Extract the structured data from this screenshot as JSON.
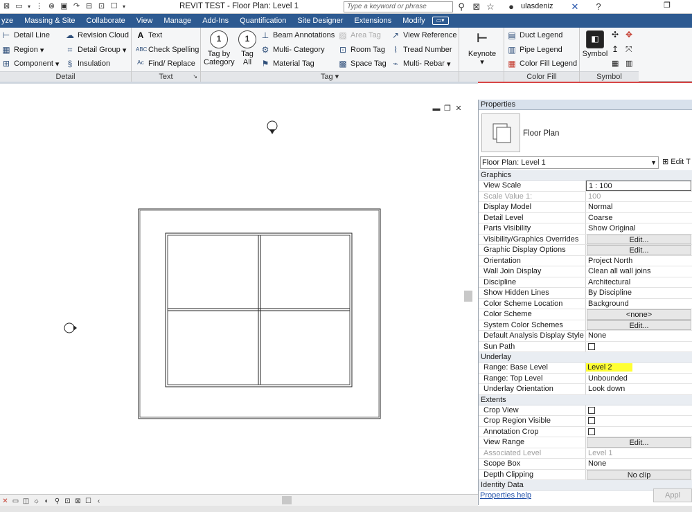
{
  "titlebar": {
    "title": "REVIT TEST - Floor Plan: Level 1",
    "search_placeholder": "Type a keyword or phrase",
    "user": "ulasdeniz",
    "qat_icons": [
      "close-x-icon",
      "open-icon",
      "save-icon",
      "undo-icon",
      "settings-icon",
      "redo-icon",
      "print-icon",
      "measure-icon",
      "sync-icon"
    ]
  },
  "tabs": [
    "yze",
    "Massing & Site",
    "Collaborate",
    "View",
    "Manage",
    "Add-Ins",
    "Quantification",
    "Site Designer",
    "Extensions",
    "Modify"
  ],
  "ribbon": {
    "detail": {
      "title": "Detail",
      "items": [
        "Detail Line",
        "Region",
        "Component",
        "Revision Cloud",
        "Detail Group",
        "Insulation"
      ]
    },
    "text": {
      "title": "Text",
      "items": [
        "Text",
        "Check Spelling",
        "Find/ Replace"
      ]
    },
    "tag": {
      "title": "Tag",
      "tag_by_category": "Tag by Category",
      "tag_all": "Tag All",
      "items": [
        "Beam Annotations",
        "Multi- Category",
        "Material Tag",
        "Area Tag",
        "Room Tag",
        "Space Tag",
        "View Reference",
        "Tread Number",
        "Multi- Rebar"
      ]
    },
    "keynote": {
      "label": "Keynote"
    },
    "color_fill": {
      "title": "Color Fill",
      "items": [
        "Duct Legend",
        "Pipe Legend",
        "Color Fill Legend"
      ]
    },
    "symbol": {
      "title": "Symbol",
      "label": "Symbol"
    }
  },
  "properties": {
    "title": "Properties",
    "type_name": "Floor Plan",
    "instance": "Floor Plan: Level 1",
    "edit_type": "Edit T",
    "groups": {
      "graphics": "Graphics",
      "underlay": "Underlay",
      "extents": "Extents",
      "identity": "Identity Data"
    },
    "graphics_rows": [
      {
        "k": "View Scale",
        "v": "1 : 100"
      },
      {
        "k": "Scale Value    1:",
        "v": "100"
      },
      {
        "k": "Display Model",
        "v": "Normal"
      },
      {
        "k": "Detail Level",
        "v": "Coarse"
      },
      {
        "k": "Parts Visibility",
        "v": "Show Original"
      },
      {
        "k": "Visibility/Graphics Overrides",
        "v": "Edit..."
      },
      {
        "k": "Graphic Display Options",
        "v": "Edit..."
      },
      {
        "k": "Orientation",
        "v": "Project North"
      },
      {
        "k": "Wall Join Display",
        "v": "Clean all wall joins"
      },
      {
        "k": "Discipline",
        "v": "Architectural"
      },
      {
        "k": "Show Hidden Lines",
        "v": "By Discipline"
      },
      {
        "k": "Color Scheme Location",
        "v": "Background"
      },
      {
        "k": "Color Scheme",
        "v": "<none>"
      },
      {
        "k": "System Color Schemes",
        "v": "Edit..."
      },
      {
        "k": "Default Analysis Display Style",
        "v": "None"
      },
      {
        "k": "Sun Path",
        "v": ""
      }
    ],
    "underlay_rows": [
      {
        "k": "Range: Base Level",
        "v": "Level 2"
      },
      {
        "k": "Range: Top Level",
        "v": "Unbounded"
      },
      {
        "k": "Underlay Orientation",
        "v": "Look down"
      }
    ],
    "extents_rows": [
      {
        "k": "Crop View",
        "v": ""
      },
      {
        "k": "Crop Region Visible",
        "v": ""
      },
      {
        "k": "Annotation Crop",
        "v": ""
      },
      {
        "k": "View Range",
        "v": "Edit..."
      },
      {
        "k": "Associated Level",
        "v": "Level 1"
      },
      {
        "k": "Scope Box",
        "v": "None"
      },
      {
        "k": "Depth Clipping",
        "v": "No clip"
      }
    ],
    "help": "Properties help",
    "apply": "Appl"
  },
  "colors": {
    "tab_bar": "#2d5a91",
    "highlight": "#ffff33",
    "accent_red": "#d84545"
  }
}
